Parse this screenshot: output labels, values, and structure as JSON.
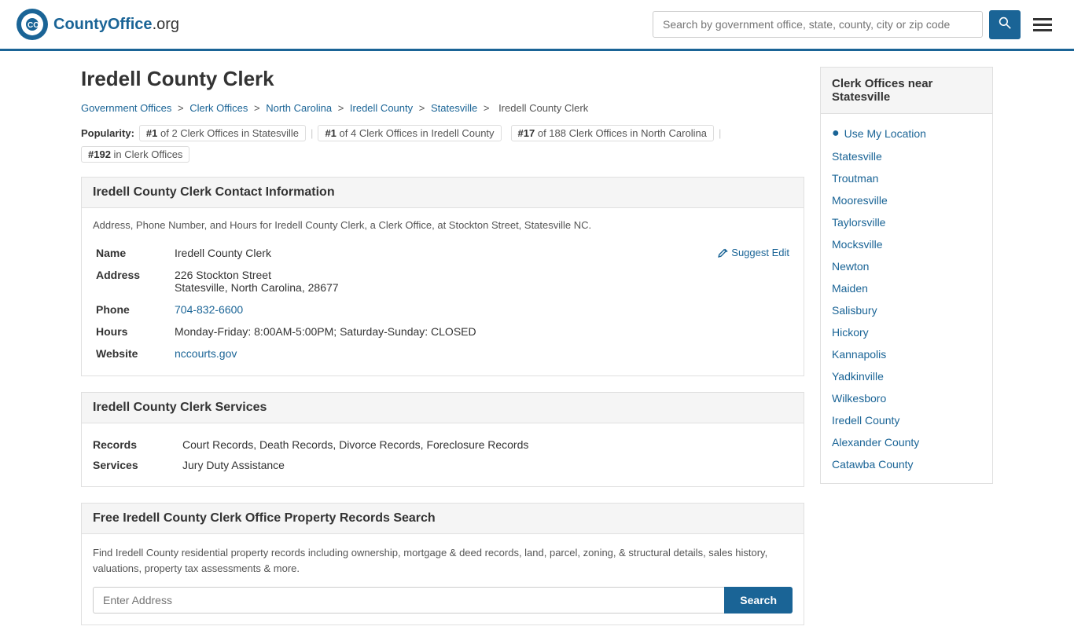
{
  "header": {
    "logo_text": "CountyOffice",
    "logo_suffix": ".org",
    "search_placeholder": "Search by government office, state, county, city or zip code",
    "search_button_label": "🔍"
  },
  "page": {
    "title": "Iredell County Clerk"
  },
  "breadcrumb": {
    "items": [
      "Government Offices",
      "Clerk Offices",
      "North Carolina",
      "Iredell County",
      "Statesville",
      "Iredell County Clerk"
    ]
  },
  "popularity": {
    "label": "Popularity:",
    "badges": [
      "#1 of 2 Clerk Offices in Statesville",
      "#1 of 4 Clerk Offices in Iredell County",
      "#17 of 188 Clerk Offices in North Carolina",
      "#192 in Clerk Offices"
    ]
  },
  "contact": {
    "section_title": "Iredell County Clerk Contact Information",
    "description": "Address, Phone Number, and Hours for Iredell County Clerk, a Clerk Office, at Stockton Street, Statesville NC.",
    "fields": {
      "name_label": "Name",
      "name_value": "Iredell County Clerk",
      "address_label": "Address",
      "address_line1": "226 Stockton Street",
      "address_line2": "Statesville, North Carolina, 28677",
      "phone_label": "Phone",
      "phone_value": "704-832-6600",
      "hours_label": "Hours",
      "hours_value": "Monday-Friday: 8:00AM-5:00PM; Saturday-Sunday: CLOSED",
      "website_label": "Website",
      "website_value": "nccourts.gov",
      "suggest_edit": "Suggest Edit"
    }
  },
  "services": {
    "section_title": "Iredell County Clerk Services",
    "records_label": "Records",
    "records_value": "Court Records, Death Records, Divorce Records, Foreclosure Records",
    "services_label": "Services",
    "services_value": "Jury Duty Assistance"
  },
  "property_search": {
    "section_title": "Free Iredell County Clerk Office Property Records Search",
    "description": "Find Iredell County residential property records including ownership, mortgage & deed records, land, parcel, zoning, & structural details, sales history, valuations, property tax assessments & more.",
    "address_placeholder": "Enter Address",
    "search_button": "Search"
  },
  "sidebar": {
    "title": "Clerk Offices near Statesville",
    "use_location": "Use My Location",
    "links": [
      "Statesville",
      "Troutman",
      "Mooresville",
      "Taylorsville",
      "Mocksville",
      "Newton",
      "Maiden",
      "Salisbury",
      "Hickory",
      "Kannapolis",
      "Yadkinville",
      "Wilkesboro",
      "Iredell County",
      "Alexander County",
      "Catawba County"
    ]
  }
}
